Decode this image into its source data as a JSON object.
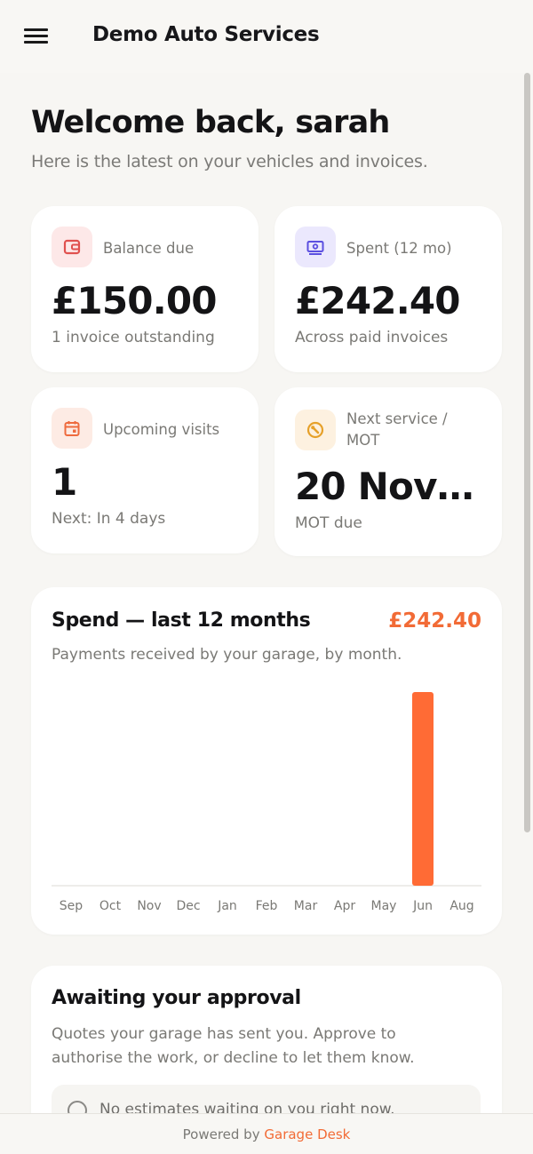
{
  "header": {
    "brand": "Demo Auto Services",
    "menu_icon": "hamburger-menu-icon"
  },
  "welcome": {
    "title": "Welcome back, sarah",
    "subtitle": "Here is the latest on your vehicles and invoices."
  },
  "stats": [
    {
      "label": "Balance due",
      "value": "£150.00",
      "sub": "1 invoice outstanding",
      "icon": "wallet-icon",
      "icon_bg": "#fde8e8",
      "icon_color": "#e0514f"
    },
    {
      "label": "Spent (12 mo)",
      "value": "£242.40",
      "sub": "Across paid invoices",
      "icon": "cash-icon",
      "icon_bg": "#ebe8fd",
      "icon_color": "#5b4fe0"
    },
    {
      "label": "Upcoming visits",
      "value": "1",
      "sub": "Next: In 4 days",
      "icon": "calendar-icon",
      "icon_bg": "#fdebe4",
      "icon_color": "#ee6b3e"
    },
    {
      "label_lines": [
        "Next service /",
        "MOT"
      ],
      "value": "20 Nov 2...",
      "sub": "MOT due",
      "icon": "wrench-icon",
      "icon_bg": "#fdf1e0",
      "icon_color": "#e6a12a"
    }
  ],
  "spend": {
    "title": "Spend — last 12 months",
    "total": "£242.40",
    "subtitle": "Payments received by your garage, by month."
  },
  "chart_data": {
    "type": "bar",
    "categories": [
      "Sep",
      "Oct",
      "Nov",
      "Dec",
      "Jan",
      "Feb",
      "Mar",
      "Apr",
      "May",
      "Jun",
      "Aug"
    ],
    "values": [
      0,
      0,
      0,
      0,
      0,
      0,
      0,
      0,
      0,
      242.4,
      0
    ],
    "bar_color": "#ff6b35",
    "grid": false
  },
  "approval": {
    "title": "Awaiting your approval",
    "subtitle": "Quotes your garage has sent you. Approve to authorise the work, or decline to let them know.",
    "empty_text": "No estimates waiting on you right now.",
    "empty_icon": "check-circle-icon"
  },
  "footer": {
    "prefix": "Powered by",
    "link": "Garage Desk"
  },
  "colors": {
    "accent": "#f26b36",
    "background": "#f7f6f3",
    "card": "#ffffff"
  }
}
